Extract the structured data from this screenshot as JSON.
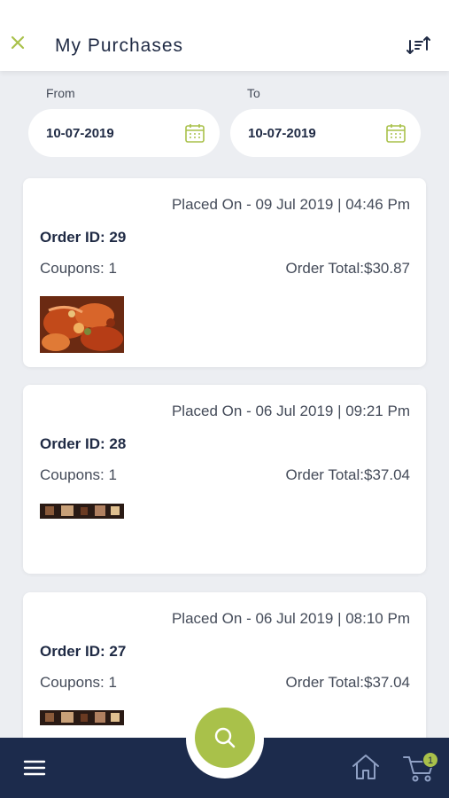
{
  "header": {
    "title": "My Purchases",
    "close_icon": "close-icon",
    "sort_icon": "sort-icon"
  },
  "filters": {
    "from_label": "From",
    "from_value": "10-07-2019",
    "to_label": "To",
    "to_value": "10-07-2019"
  },
  "orders": [
    {
      "placed_on": "Placed On - 09 Jul 2019 | 04:46 Pm",
      "order_id": "Order ID: 29",
      "coupons": "Coupons: 1",
      "total": "Order Total:$30.87"
    },
    {
      "placed_on": "Placed On - 06 Jul 2019 | 09:21 Pm",
      "order_id": "Order ID: 28",
      "coupons": "Coupons: 1",
      "total": "Order Total:$37.04"
    },
    {
      "placed_on": "Placed On - 06 Jul 2019 | 08:10 Pm",
      "order_id": "Order ID: 27",
      "coupons": "Coupons: 1",
      "total": "Order Total:$37.04"
    }
  ],
  "nav": {
    "cart_count": "1"
  },
  "colors": {
    "accent": "#a9c14a",
    "navy": "#1c2b4c",
    "background": "#eceef2"
  }
}
